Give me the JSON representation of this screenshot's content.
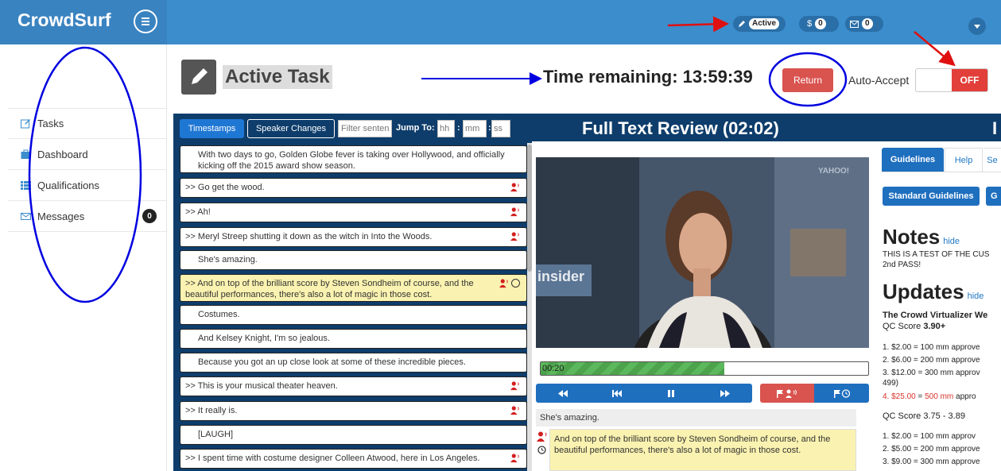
{
  "app": {
    "brand": "CrowdSurf"
  },
  "topbar": {
    "status_label": "Active",
    "dollar_label": "$",
    "dollar_count": "0",
    "mail_count": "0"
  },
  "sidebar": {
    "items": [
      {
        "label": "Tasks",
        "icon": "edit-icon"
      },
      {
        "label": "Dashboard",
        "icon": "briefcase-icon"
      },
      {
        "label": "Qualifications",
        "icon": "list-icon"
      },
      {
        "label": "Messages",
        "icon": "envelope-icon",
        "count": "0"
      }
    ]
  },
  "header": {
    "title": "Active Task",
    "time_remaining": "Time remaining: 13:59:39",
    "return_label": "Return",
    "auto_accept_label": "Auto-Accept",
    "toggle_state": "OFF"
  },
  "review": {
    "tab_timestamps": "Timestamps",
    "tab_speaker_changes": "Speaker Changes",
    "filter_placeholder": "Filter senten",
    "jump_to_label": "Jump To:",
    "hh": "hh",
    "mm": "mm",
    "ss": "ss",
    "title": "Full Text Review (02:02)",
    "title_trailing": "I"
  },
  "segments": [
    {
      "text": "With two days to go, Golden Globe fever is taking over Hollywood, and officially kicking off the 2015 award show season.",
      "speaker_change": false
    },
    {
      "text": ">> Go get the wood.",
      "speaker_change": true
    },
    {
      "text": ">> Ah!",
      "speaker_change": true
    },
    {
      "text": ">> Meryl Streep shutting it down as the witch in Into the Woods.",
      "speaker_change": true
    },
    {
      "text": "She's amazing.",
      "speaker_change": false
    },
    {
      "text": ">> And on top of the brilliant score by Steven Sondheim of course, and the beautiful performances, there's also a lot of magic in those cost.",
      "speaker_change": true,
      "active": true
    },
    {
      "text": "Costumes.",
      "speaker_change": false
    },
    {
      "text": "And Kelsey Knight, I'm so jealous.",
      "speaker_change": false
    },
    {
      "text": "Because you got an up close look at some of these incredible pieces.",
      "speaker_change": false
    },
    {
      "text": ">> This is your musical theater heaven.",
      "speaker_change": true
    },
    {
      "text": ">> It really is.",
      "speaker_change": true
    },
    {
      "text": "[LAUGH]",
      "speaker_change": false
    },
    {
      "text": ">> I spent time with costume designer Colleen Atwood, here in Los Angeles.",
      "speaker_change": true
    }
  ],
  "player": {
    "watermark": "YAHOO!",
    "overlay_text": "insider",
    "current_time": "00:20",
    "progress": 0.56,
    "current_segment": "She's amazing.",
    "edit_text": "And on top of the brilliant score by Steven Sondheim of course, and the beautiful performances, there's also a lot of magic in those cost."
  },
  "guidelines": {
    "tabs": [
      "Guidelines",
      "Help",
      "Se"
    ],
    "standard_button": "Standard Guidelines",
    "second_button": "G",
    "notes_title": "Notes",
    "hide_label": "hide",
    "notes_text_1": "THIS IS A TEST OF THE CUS",
    "notes_text_2": "2nd PASS!",
    "updates_title": "Updates",
    "updates_heading": "The Crowd Virtualizer We",
    "qc1_prefix": "QC Score ",
    "qc1_value": "3.90+",
    "list1": [
      "1.  $2.00 = 100 mm approve",
      "2.  $6.00 = 200 mm approve",
      "3.  $12.00 = 300 mm approv",
      "     499)"
    ],
    "list1_red_num": "4.  ",
    "list1_red_a": "$25.00",
    "list1_red_eq": " = ",
    "list1_red_b": "500 mm",
    "list1_red_tail": " appro",
    "qc2": "QC Score 3.75 - 3.89",
    "list2": [
      "1.  $2.00 = 100 mm  approv",
      "2.  $5.00 = 200 mm approve",
      "3.  $9.00 = 300 mm approve"
    ]
  },
  "colors": {
    "topbar": "#3c8dcc",
    "panel_header": "#0e3d6b",
    "primary": "#1f6fbf",
    "danger": "#d9534f",
    "highlight": "#faf2b0",
    "annotation_red": "#e01010",
    "annotation_blue": "#0000e0"
  }
}
